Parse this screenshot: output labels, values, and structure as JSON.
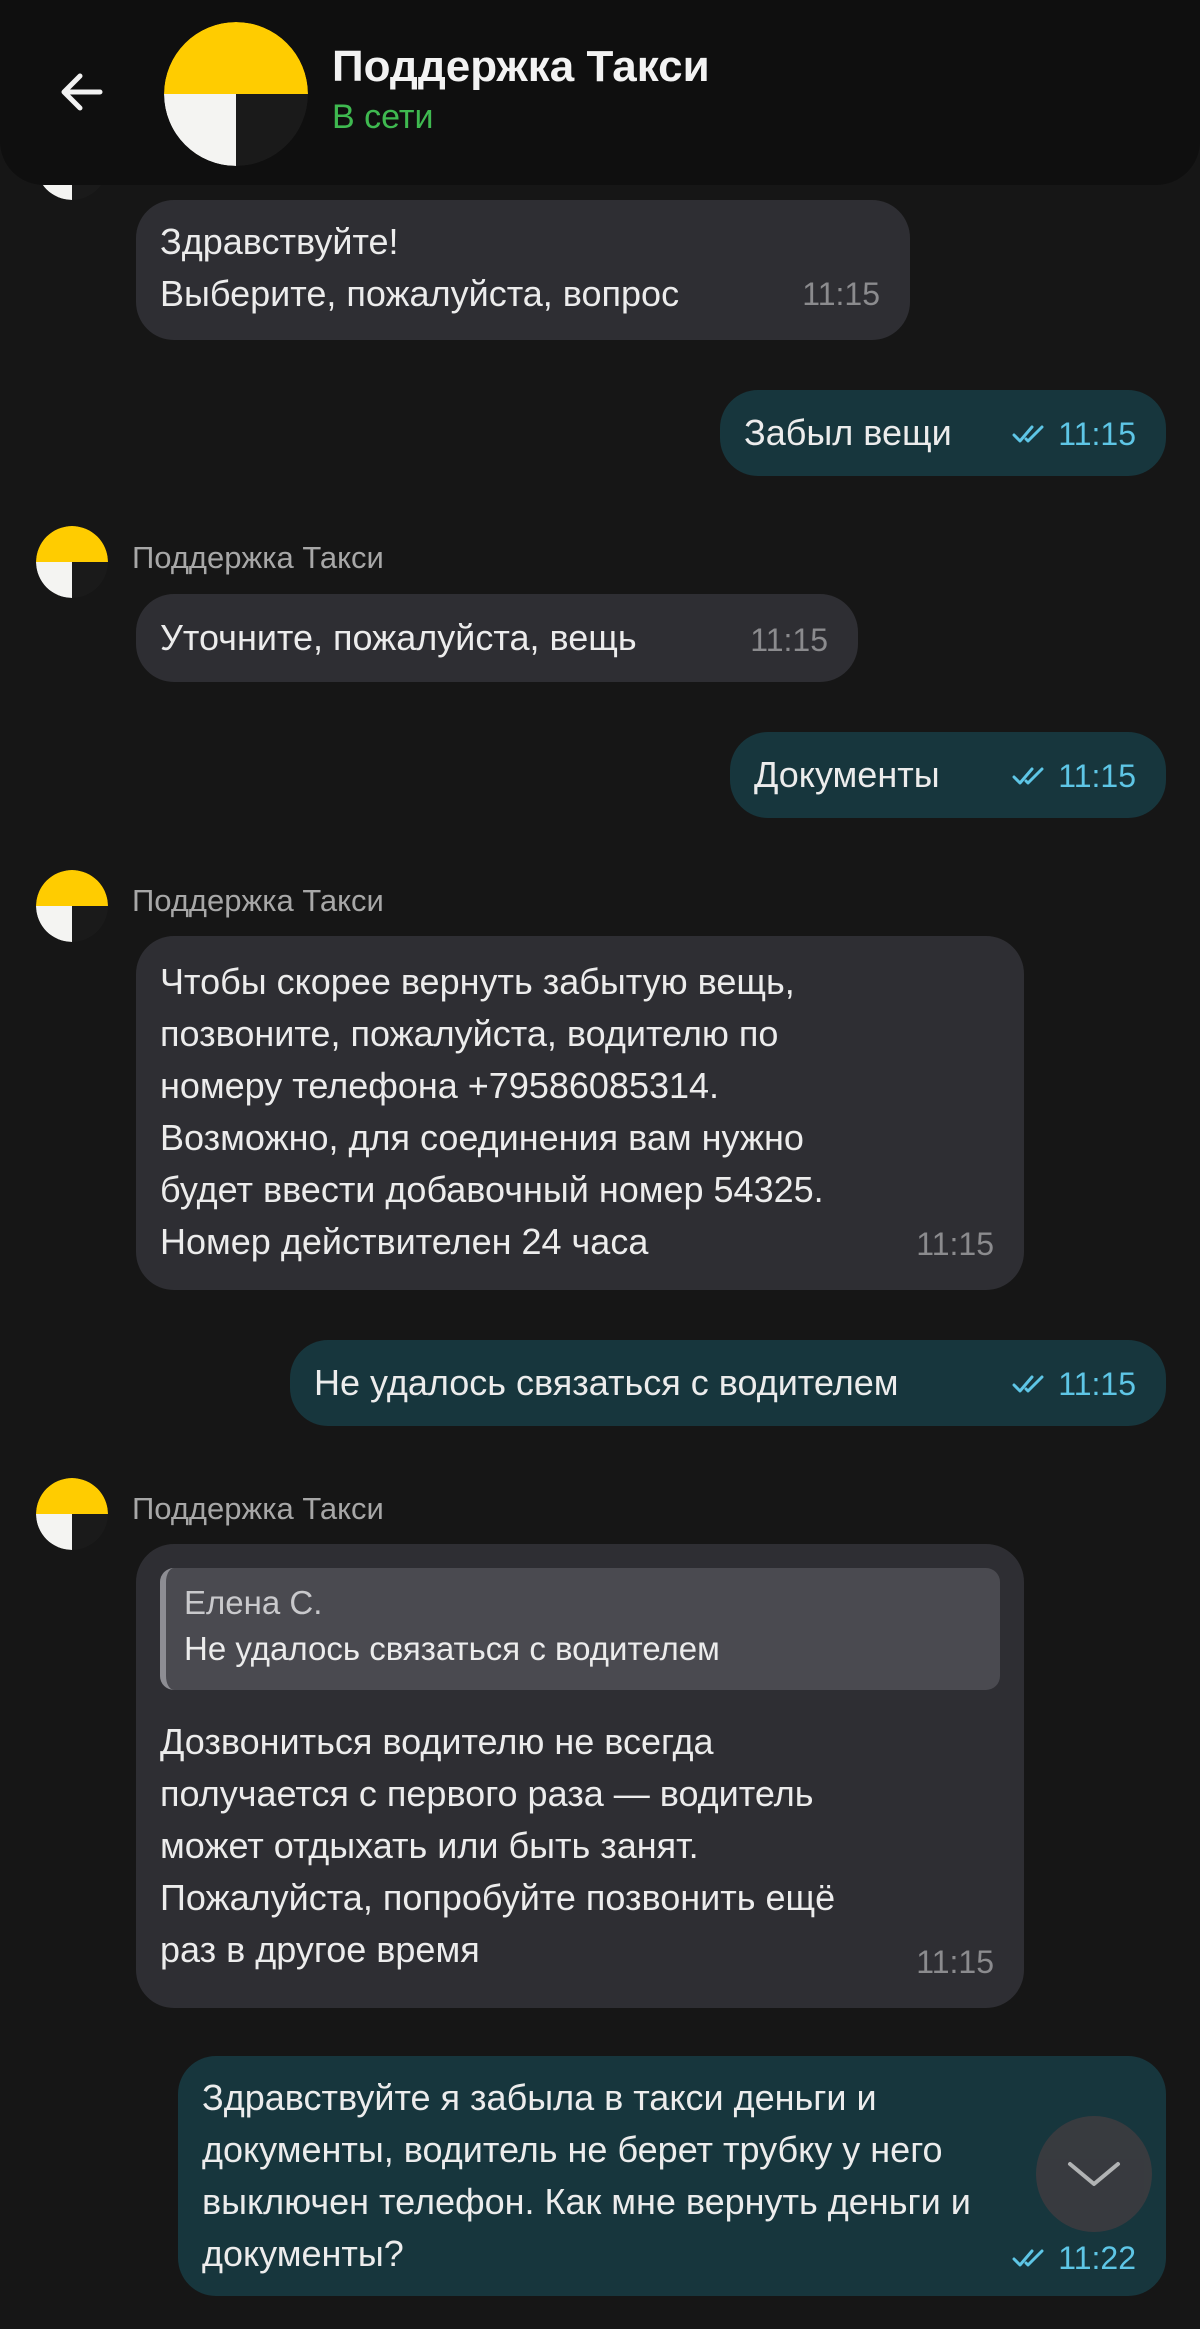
{
  "header": {
    "title": "Поддержка Такси",
    "status": "В сети",
    "back_icon": "arrow-left-icon"
  },
  "messages": [
    {
      "type": "in",
      "text": "Здравствуйте!\nВыберите, пожалуйста, вопрос",
      "time": "11:15"
    },
    {
      "type": "out",
      "text": "Забыл вещи",
      "time": "11:15",
      "read": true
    },
    {
      "type": "in",
      "sender": "Поддержка Такси",
      "text": "Уточните, пожалуйста, вещь",
      "time": "11:15"
    },
    {
      "type": "out",
      "text": "Документы",
      "time": "11:15",
      "read": true
    },
    {
      "type": "in",
      "sender": "Поддержка Такси",
      "text": "Чтобы скорее вернуть забытую вещь,\nпозвоните, пожалуйста, водителю по\nномеру телефона +79586085314.\nВозможно, для соединения вам нужно\nбудет ввести  добавочный номер 54325.\nНомер действителен 24 часа",
      "time": "11:15"
    },
    {
      "type": "out",
      "text": "Не удалось связаться с водителем",
      "time": "11:15",
      "read": true
    },
    {
      "type": "in",
      "sender": "Поддержка Такси",
      "quote": {
        "author": "Елена С.",
        "text": "Не удалось связаться с водителем"
      },
      "text": "Дозвониться водителю не всегда\nполучается с первого раза — водитель\nможет отдыхать или быть занят.\nПожалуйста, попробуйте позвонить ещё\nраз в другое время",
      "time": "11:15"
    },
    {
      "type": "out",
      "text": "Здравствуйте я забыла в такси деньги и\nдокументы, водитель не берет трубку у него\nвыключен телефон. Как мне вернуть деньги и\nдокументы?",
      "time": "11:22",
      "read": true
    }
  ],
  "scroll_button": {
    "icon": "chevron-down-icon"
  },
  "colors": {
    "background": "#161616",
    "incoming_bubble": "#2e2e33",
    "outgoing_bubble": "#17363d",
    "online": "#3fb950",
    "read_check": "#5ec6e6",
    "logo_yellow": "#ffcc00"
  }
}
